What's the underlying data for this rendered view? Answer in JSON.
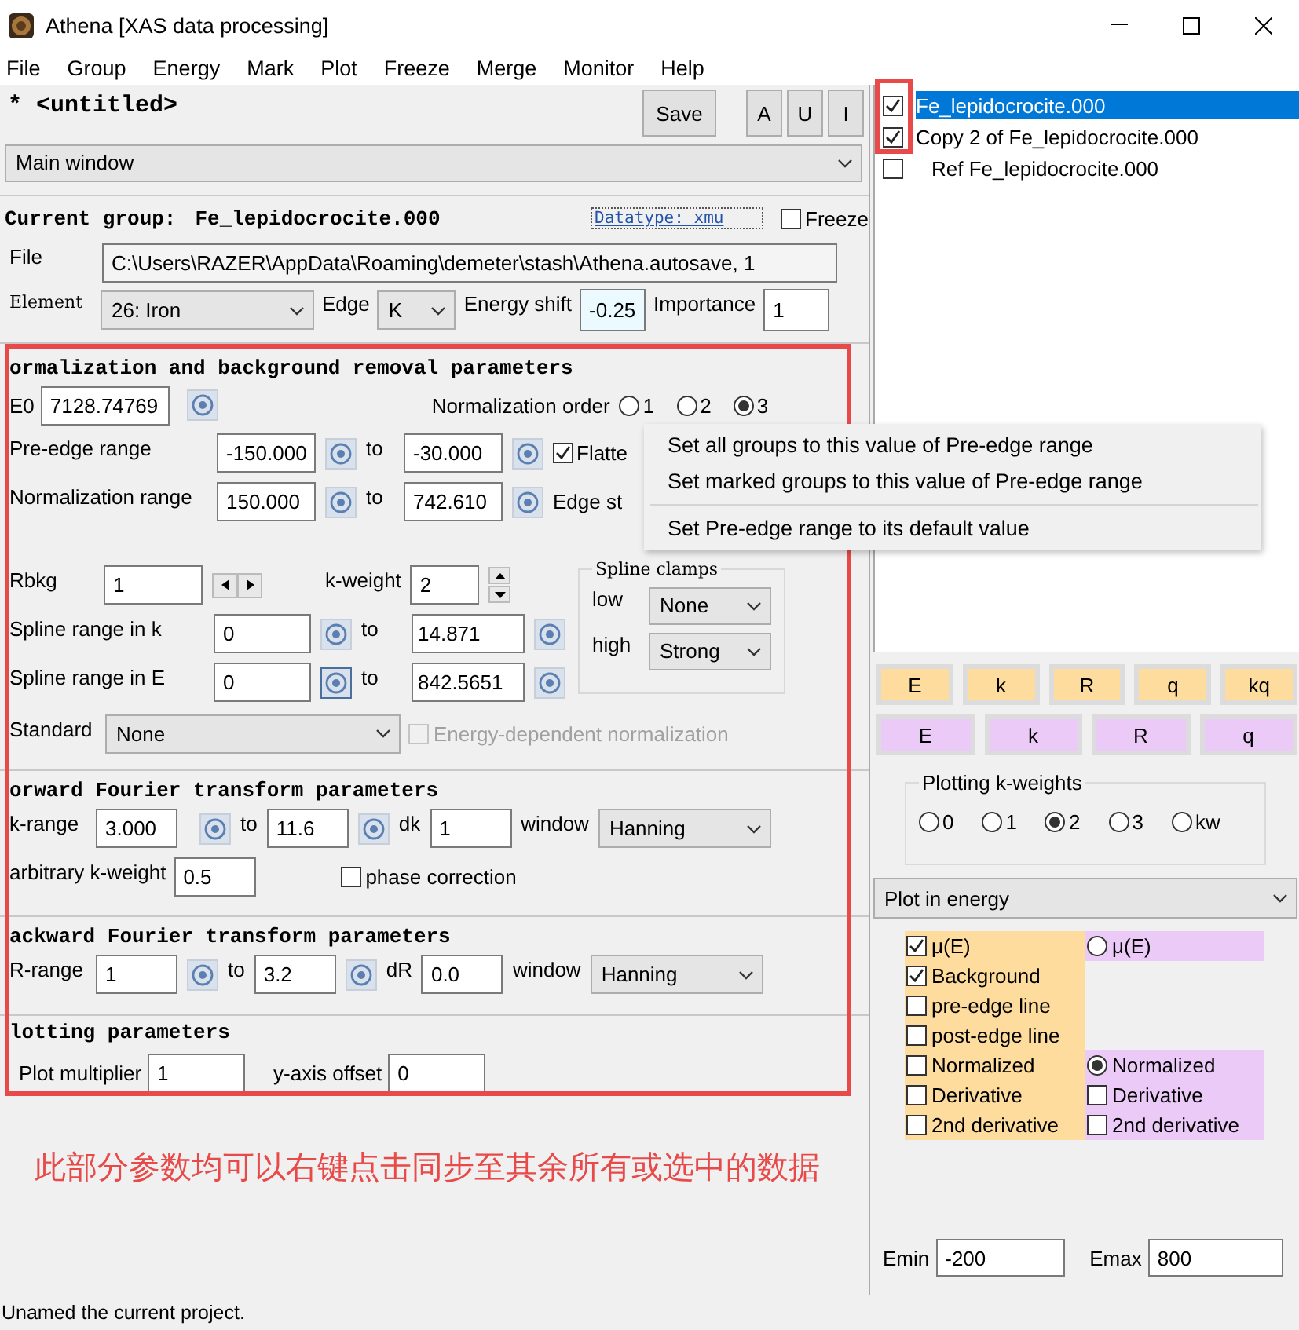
{
  "window": {
    "title": "Athena [XAS data processing]"
  },
  "menu": [
    "File",
    "Group",
    "Energy",
    "Mark",
    "Plot",
    "Freeze",
    "Merge",
    "Monitor",
    "Help"
  ],
  "project": {
    "title": "* <untitled>",
    "save": "Save",
    "buttons": [
      "A",
      "U",
      "I"
    ]
  },
  "view": "Main window",
  "group": {
    "label": "Current group:",
    "name": "Fe_lepidocrocite.000",
    "datatype": "Datatype: xmu",
    "freeze": {
      "label": "Freeze",
      "checked": false
    }
  },
  "file": {
    "label": "File",
    "value": "C:\\Users\\RAZER\\AppData\\Roaming\\demeter\\stash\\Athena.autosave, 1"
  },
  "element": {
    "label": "Element",
    "value": "26: Iron"
  },
  "edge": {
    "label": "Edge",
    "value": "K"
  },
  "energy_shift": {
    "label": "Energy shift",
    "value": "-0.25"
  },
  "importance": {
    "label": "Importance",
    "value": "1"
  },
  "normalization": {
    "title": "ormalization and background removal parameters",
    "e0": {
      "label": "E0",
      "value": "7128.74769"
    },
    "order": {
      "label": "Normalization order",
      "options": [
        {
          "label": "1",
          "selected": false
        },
        {
          "label": "2",
          "selected": false
        },
        {
          "label": "3",
          "selected": true
        }
      ]
    },
    "ranges": [
      {
        "label": "Pre-edge range",
        "from": "-150.000",
        "to_label": "to",
        "to": "-30.000",
        "extra": {
          "kind": "check",
          "label": "Flatte",
          "checked": true
        }
      },
      {
        "label": "Normalization range",
        "from": "150.000",
        "to_label": "to",
        "to": "742.610",
        "extra": {
          "kind": "text",
          "label": "Edge st"
        }
      }
    ],
    "rbkg": {
      "label": "Rbkg",
      "value": "1"
    },
    "kweight": {
      "label": "k-weight",
      "value": "2"
    },
    "spline_ranges": [
      {
        "label": "Spline range in k",
        "from": "0",
        "to_label": "to",
        "to": "14.871"
      },
      {
        "label": "Spline range in E",
        "from": "0",
        "to_label": "to",
        "to": "842.5651"
      }
    ],
    "clamps": {
      "title": "Spline clamps",
      "rows": [
        {
          "label": "low",
          "value": "None"
        },
        {
          "label": "high",
          "value": "Strong"
        }
      ]
    },
    "standard": {
      "label": "Standard",
      "value": "None"
    },
    "energy_dependent": {
      "label": "Energy-dependent normalization",
      "checked": false,
      "disabled": true
    }
  },
  "forward": {
    "title": "orward Fourier transform parameters",
    "range": {
      "label": "k-range",
      "from": "3.000",
      "to_label": "to",
      "to": "11.6"
    },
    "step": {
      "label": "dk",
      "value": "1"
    },
    "window": {
      "label": "window",
      "value": "Hanning"
    },
    "arbitrary": {
      "label": "arbitrary k-weight",
      "value": "0.5"
    },
    "phase": {
      "label": "phase correction",
      "checked": false
    }
  },
  "backward": {
    "title": "ackward Fourier transform parameters",
    "range": {
      "label": "R-range",
      "from": "1",
      "to_label": "to",
      "to": "3.2"
    },
    "step": {
      "label": "dR",
      "value": "0.0"
    },
    "window": {
      "label": "window",
      "value": "Hanning"
    }
  },
  "plotting": {
    "title": "lotting parameters",
    "multiplier": {
      "label": "Plot multiplier",
      "value": "1"
    },
    "offset": {
      "label": "y-axis offset",
      "value": "0"
    }
  },
  "annotation": "此部分参数均可以右键点击同步至其余所有或选中的数据",
  "context_menu": {
    "sections": [
      [
        "Set all groups to this value of Pre-edge range",
        "Set marked groups to this value of Pre-edge range"
      ],
      [
        "Set Pre-edge range to its default value"
      ]
    ]
  },
  "groups": [
    {
      "name": "Fe_lepidocrocite.000",
      "checked": true,
      "selected": true,
      "kind": "data"
    },
    {
      "name": "Copy 2 of Fe_lepidocrocite.000",
      "checked": true,
      "selected": false,
      "kind": "data"
    },
    {
      "name": "Ref Fe_lepidocrocite.000",
      "checked": false,
      "selected": false,
      "kind": "reference"
    }
  ],
  "plot_buttons": [
    {
      "color": "#fddc9e",
      "buttons": [
        "E",
        "k",
        "R",
        "q",
        "kq"
      ]
    },
    {
      "color": "#eccaf8",
      "buttons": [
        "E",
        "k",
        "R",
        "q"
      ]
    }
  ],
  "kweights": {
    "title": "Plotting k-weights",
    "options": [
      {
        "label": "0",
        "selected": false
      },
      {
        "label": "1",
        "selected": false
      },
      {
        "label": "2",
        "selected": true
      },
      {
        "label": "3",
        "selected": false
      },
      {
        "label": "kw",
        "selected": false
      }
    ]
  },
  "plot_space": "Plot in energy",
  "energy_options": {
    "single": {
      "color": "#fddc9e",
      "items": [
        {
          "kind": "check",
          "label": "μ(E)",
          "checked": true
        },
        {
          "kind": "check",
          "label": "Background",
          "checked": true
        },
        {
          "kind": "check",
          "label": "pre-edge line",
          "checked": false
        },
        {
          "kind": "check",
          "label": "post-edge line",
          "checked": false
        },
        {
          "kind": "check",
          "label": "Normalized",
          "checked": false
        },
        {
          "kind": "check",
          "label": "Derivative",
          "checked": false
        },
        {
          "kind": "check",
          "label": "2nd derivative",
          "checked": false
        }
      ]
    },
    "marked": {
      "color": "#eccaf8",
      "items": [
        {
          "kind": "radio",
          "label": "μ(E)",
          "selected": false
        },
        {
          "kind": "blank"
        },
        {
          "kind": "blank"
        },
        {
          "kind": "blank"
        },
        {
          "kind": "radio",
          "label": "Normalized",
          "selected": true
        },
        {
          "kind": "check",
          "label": "Derivative",
          "checked": false
        },
        {
          "kind": "check",
          "label": "2nd derivative",
          "checked": false
        }
      ]
    }
  },
  "energy_limits": [
    {
      "label": "Emin",
      "value": "-200"
    },
    {
      "label": "Emax",
      "value": "800"
    }
  ],
  "status": "Unamed the current project."
}
